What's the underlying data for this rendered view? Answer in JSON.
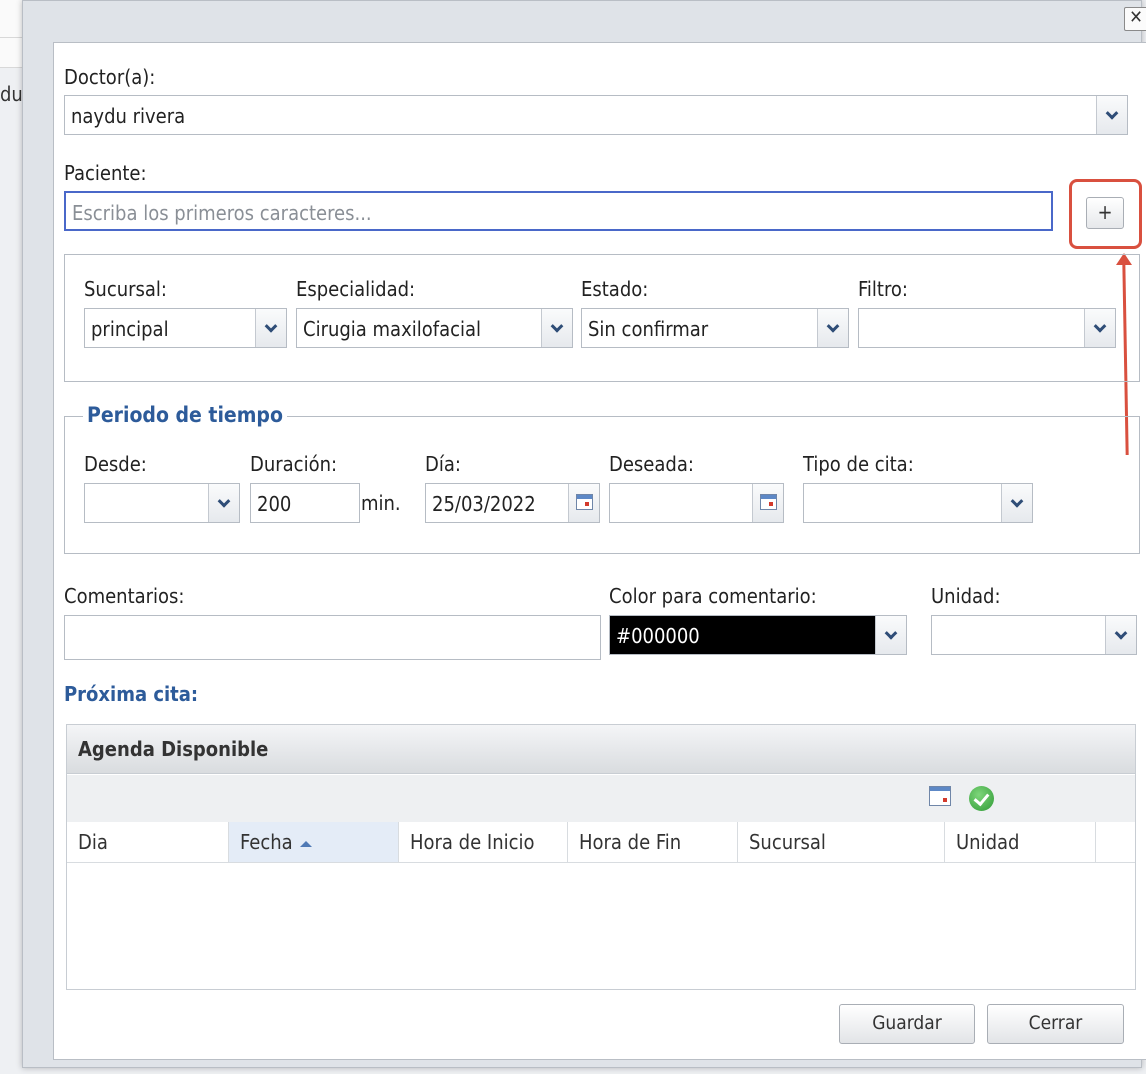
{
  "background": {
    "text": "du"
  },
  "dialog": {
    "close_label": "✕"
  },
  "doctor": {
    "label": "Doctor(a):",
    "value": "naydu rivera"
  },
  "paciente": {
    "label": "Paciente:",
    "placeholder": "Escriba los primeros caracteres...",
    "add_label": "+"
  },
  "filters": {
    "sucursal": {
      "label": "Sucursal:",
      "value": "principal"
    },
    "especialidad": {
      "label": "Especialidad:",
      "value": "Cirugia maxilofacial"
    },
    "estado": {
      "label": "Estado:",
      "value": "Sin confirmar"
    },
    "filtro": {
      "label": "Filtro:",
      "value": ""
    }
  },
  "periodo": {
    "legend": "Periodo de tiempo",
    "desde": {
      "label": "Desde:",
      "value": ""
    },
    "duracion": {
      "label": "Duración:",
      "value": "200",
      "unit": "min."
    },
    "dia": {
      "label": "Día:",
      "value": "25/03/2022"
    },
    "deseada": {
      "label": "Deseada:",
      "value": ""
    },
    "tipo": {
      "label": "Tipo de cita:",
      "value": ""
    }
  },
  "comentarios": {
    "label": "Comentarios:",
    "value": ""
  },
  "color_comentario": {
    "label": "Color para comentario:",
    "value": "#000000",
    "color": "#000000"
  },
  "unidad": {
    "label": "Unidad:",
    "value": ""
  },
  "proxima": {
    "title": "Próxima cita:"
  },
  "agenda": {
    "title": "Agenda Disponible",
    "columns": [
      "Dia",
      "Fecha",
      "Hora de Inicio",
      "Hora de Fin",
      "Sucursal",
      "Unidad"
    ],
    "sorted_column": "Fecha"
  },
  "buttons": {
    "guardar": "Guardar",
    "cerrar": "Cerrar"
  },
  "annotation": {
    "color": "#d9503f"
  }
}
